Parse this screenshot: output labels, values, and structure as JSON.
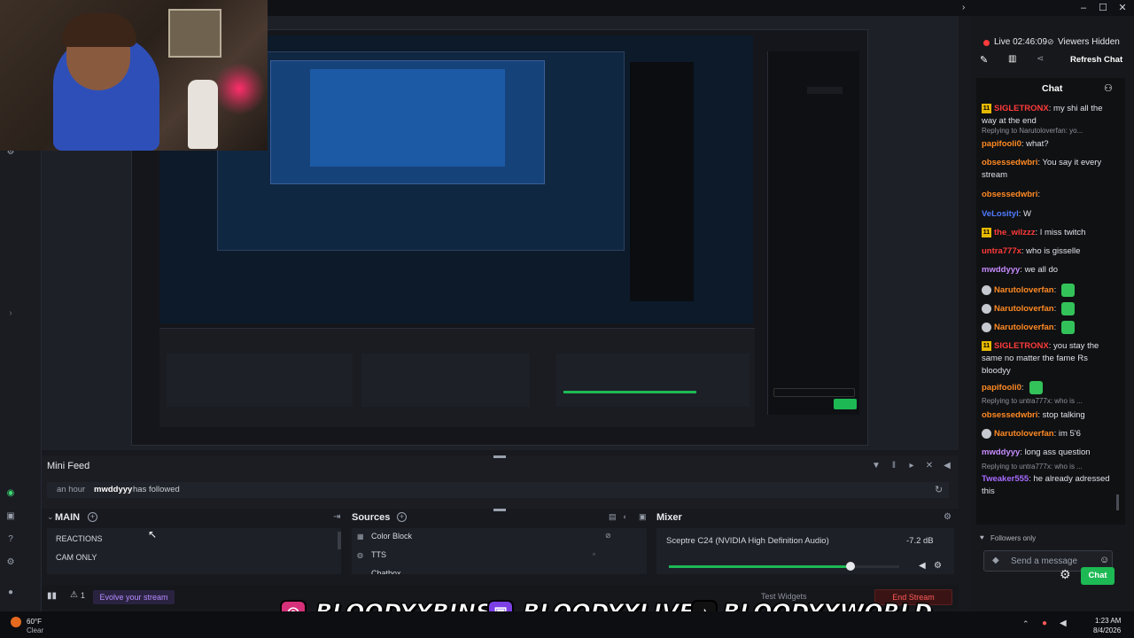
{
  "chat": {
    "live_time": "Live 02:46:09",
    "viewers": "Viewers Hidden",
    "refresh_label": "Refresh Chat",
    "title": "Chat",
    "followers_only": "Followers only",
    "input_placeholder": "Send a message",
    "send_label": "Chat",
    "messages": [
      {
        "user": "SIGLETRONX",
        "user_color": "#ff3b3b",
        "text": ": my shi all the way at the end",
        "badge": "sub"
      },
      {
        "reply": "Replying to Narutoloverfan: yo..."
      },
      {
        "user": "papifooli0",
        "user_color": "#ff8a24",
        "text": ": what?"
      },
      {
        "user": "obsessedwbri",
        "user_color": "#ff8a24",
        "text": ": You say it every stream"
      },
      {
        "user": "obsessedwbri",
        "user_color": "#ff8a24",
        "text": ":"
      },
      {
        "user": "VeLosityl",
        "user_color": "#4f7bff",
        "text": ": W"
      },
      {
        "user": "the_wilzzz",
        "user_color": "#ff3b3b",
        "text": ": I miss twitch",
        "badge": "sub"
      },
      {
        "user": "untra777x",
        "user_color": "#ff3b3b",
        "text": ": who is gisselle"
      },
      {
        "user": "mwddyyy",
        "user_color": "#c78cff",
        "text": ": we all do"
      },
      {
        "user": "Narutoloverfan",
        "user_color": "#ff8a24",
        "text": ":",
        "badge": "round",
        "emote": true
      },
      {
        "user": "Narutoloverfan",
        "user_color": "#ff8a24",
        "text": ":",
        "badge": "round",
        "emote": true
      },
      {
        "user": "Narutoloverfan",
        "user_color": "#ff8a24",
        "text": ":",
        "badge": "round",
        "emote": true
      },
      {
        "user": "SIGLETRONX",
        "user_color": "#ff3b3b",
        "text": ": you stay the same no matter the fame Rs bloodyy",
        "badge": "sub"
      },
      {
        "user": "papifooli0",
        "user_color": "#ff8a24",
        "text": ":",
        "emote": true
      },
      {
        "reply": "Replying to untra777x: who is ..."
      },
      {
        "user": "obsessedwbri",
        "user_color": "#ff8a24",
        "text": ": stop talking"
      },
      {
        "user": "Narutoloverfan",
        "user_color": "#ff8a24",
        "text": ": im 5'6",
        "badge": "round"
      },
      {
        "user": "mwddyyy",
        "user_color": "#c78cff",
        "text": ": long ass question"
      },
      {
        "reply": "Replying to untra777x: who is ..."
      },
      {
        "user": "Tweaker555",
        "user_color": "#a66bff",
        "text": ": he already adressed this"
      }
    ]
  },
  "minifeed": {
    "title": "Mini Feed",
    "time": "an hour",
    "user": "mwddyyy",
    "event": "has followed"
  },
  "scenes": {
    "title": "MAIN",
    "items": [
      "REACTIONS",
      "CAM ONLY"
    ]
  },
  "sources": {
    "title": "Sources",
    "items": [
      "Color Block",
      "TTS",
      "Chatbox"
    ]
  },
  "mixer": {
    "title": "Mixer",
    "device": "Sceptre C24 (NVIDIA High Definition Audio)",
    "level": "-7.2 dB",
    "volume_fraction": 0.79
  },
  "bottombar": {
    "evolve_label": "Evolve your stream",
    "alert_count": "1",
    "test_widgets": "Test Widgets",
    "end_stream": "End Stream"
  },
  "overlay": {
    "handle1": "BLOODYYBINS",
    "handle2": "BLOODYYLIVE",
    "handle3": "BLOODYYWORLD"
  },
  "taskbar": {
    "weather_temp": "60°F",
    "weather_cond": "Clear",
    "time": "1:23 AM",
    "date": "8/4/2026"
  },
  "colors": {
    "accent_green": "#1db954",
    "live_red": "#ff3b3b",
    "instagram": "#d6307a",
    "twitch": "#7b3fe4"
  }
}
